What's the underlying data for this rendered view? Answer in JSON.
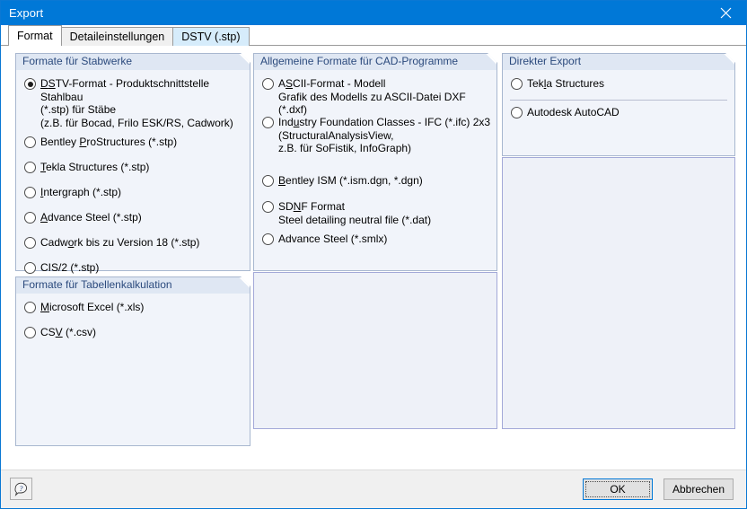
{
  "window": {
    "title": "Export",
    "close_icon": "close-icon"
  },
  "tabs": [
    {
      "label": "Format",
      "state": "active"
    },
    {
      "label": "Detaileinstellungen",
      "state": "normal"
    },
    {
      "label": "DSTV (.stp)",
      "state": "hover"
    }
  ],
  "groups": {
    "stabwerke": {
      "title": "Formate für Stabwerke",
      "options": [
        {
          "pre": "D",
          "accel": "S",
          "post": "TV-Format - Produktschnittstelle Stahlbau\n(*.stp) für Stäbe\n(z.B. für Bocad, Frilo ESK/RS, Cadwork)",
          "checked": true
        },
        {
          "pre": "Bentley ",
          "accel": "P",
          "post": "roStructures (*.stp)",
          "checked": false
        },
        {
          "pre": "",
          "accel": "T",
          "post": "ekla Structures (*.stp)",
          "checked": false
        },
        {
          "pre": "",
          "accel": "I",
          "post": "ntergraph (*.stp)",
          "checked": false
        },
        {
          "pre": "",
          "accel": "A",
          "post": "dvance Steel (*.stp)",
          "checked": false
        },
        {
          "pre": "Cadw",
          "accel": "o",
          "post": "rk bis zu Version 18 (*.stp)",
          "checked": false
        },
        {
          "pre": "CIS/2 (*.stp)",
          "accel": "",
          "post": "",
          "checked": false
        }
      ]
    },
    "tabellenkalkulation": {
      "title": "Formate für Tabellenkalkulation",
      "options": [
        {
          "pre": "",
          "accel": "M",
          "post": "icrosoft Excel (*.xls)",
          "checked": false
        },
        {
          "pre": "CS",
          "accel": "V",
          "post": " (*.csv)",
          "checked": false
        }
      ]
    },
    "cad": {
      "title": "Allgemeine Formate für CAD-Programme",
      "options": [
        {
          "pre": "A",
          "accel": "S",
          "post": "CII-Format - Modell\nGrafik des Modells zu ASCII-Datei DXF (*.dxf)",
          "checked": false
        },
        {
          "pre": "Ind",
          "accel": "u",
          "post": "stry Foundation Classes - IFC (*.ifc) 2x3\n(StructuralAnalysisView,\nz.B. für SoFistik, InfoGraph)",
          "checked": false
        },
        {
          "pre": "",
          "accel": "B",
          "post": "entley ISM (*.ism.dgn, *.dgn)",
          "checked": false
        },
        {
          "pre": "SD",
          "accel": "N",
          "post": "F Format\nSteel detailing neutral file (*.dat)",
          "checked": false
        },
        {
          "pre": "Advance Steel (*.smlx)",
          "accel": "",
          "post": "",
          "checked": false
        }
      ]
    },
    "direkter_export": {
      "title": "Direkter Export",
      "options": [
        {
          "pre": "Tek",
          "accel": "l",
          "post": "a Structures",
          "checked": false
        },
        {
          "pre": "Autodesk AutoCAD",
          "accel": "",
          "post": "",
          "checked": false
        }
      ]
    }
  },
  "footer": {
    "help_icon": "help-icon",
    "ok_label": "OK",
    "cancel_label": "Abbrechen"
  },
  "colors": {
    "titlebar": "#0078d7",
    "group_header_bg": "#dfe7f3",
    "group_header_text": "#2b4a7d",
    "group_body_bg": "#f1f4fa",
    "group_border": "#a8b7cf",
    "empty_panel_bg": "#eef1f8",
    "empty_panel_border": "#a3a9d8",
    "tab_hover_bg": "#d6ecfb",
    "accent": "#0078d7"
  }
}
